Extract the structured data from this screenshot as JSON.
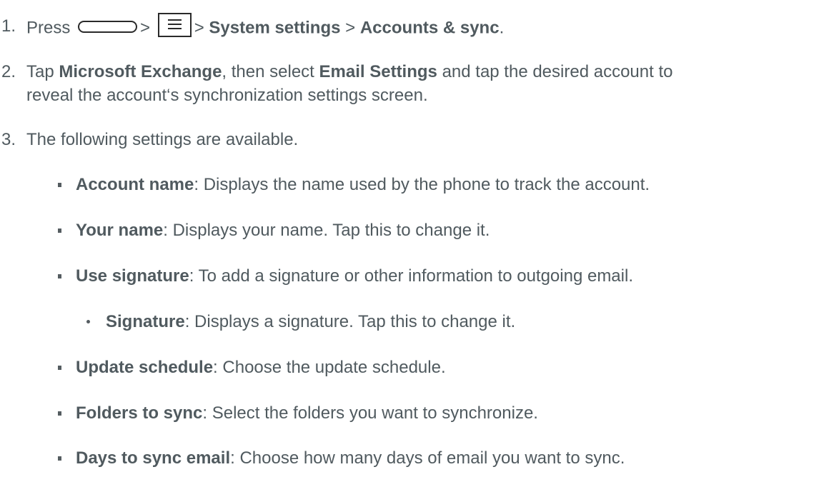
{
  "steps": [
    {
      "num": "1.",
      "press": "Press",
      "sep": ">",
      "system_settings": "System settings",
      "accounts_sync": "Accounts & sync",
      "end": "."
    },
    {
      "num": "2.",
      "tap": "Tap",
      "microsoft_exchange": "Microsoft Exchange",
      "then_select": ", then select",
      "email_settings": "Email Settings",
      "rest": "and tap the desired account to",
      "line2": "reveal the account‘s synchronization settings screen."
    },
    {
      "num": "3.",
      "text": "The following settings are available."
    }
  ],
  "icons": {
    "home": "home-key-icon",
    "menu": "menu-key-icon"
  },
  "settings": [
    {
      "term": "Account name",
      "desc": ": Displays the name used by the phone to track the account."
    },
    {
      "term": "Your name",
      "desc": ": Displays your name. Tap this to change it."
    },
    {
      "term": "Use signature",
      "desc": ": To add a signature or other information to outgoing email."
    },
    {
      "term": "Signature",
      "desc": ": Displays a signature. Tap this to change it."
    },
    {
      "term": "Update schedule",
      "desc": ": Choose the update schedule."
    },
    {
      "term": "Folders to sync",
      "desc": ": Select the folders you want to synchronize."
    },
    {
      "term": "Days to sync email",
      "desc": ": Choose how many days of email you want to sync."
    }
  ]
}
